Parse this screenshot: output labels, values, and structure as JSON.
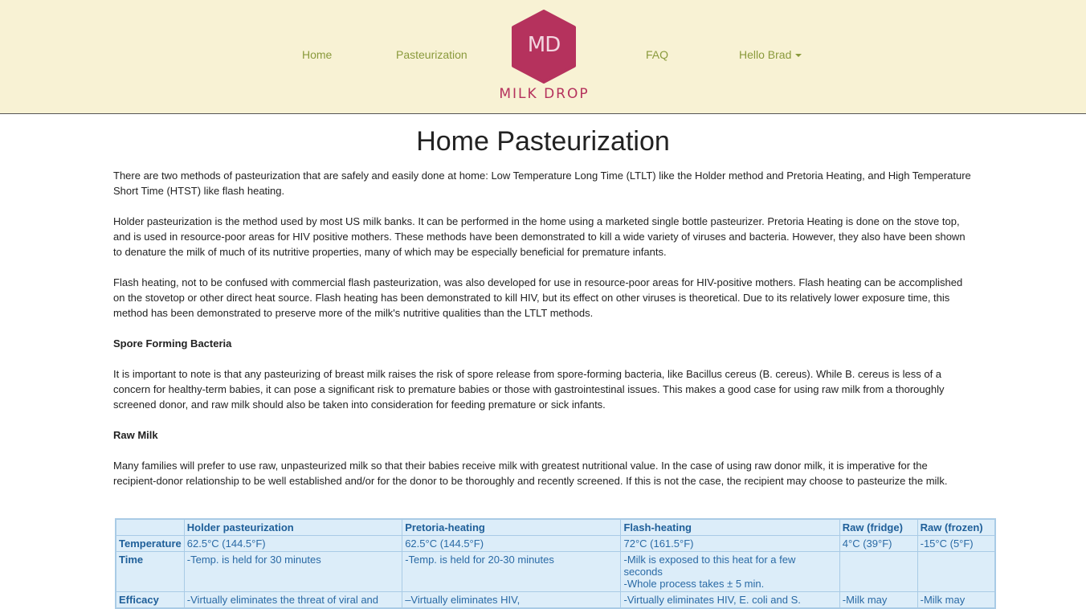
{
  "nav": {
    "home": "Home",
    "pasteurization": "Pasteurization",
    "faq": "FAQ",
    "user_menu": "Hello Brad"
  },
  "logo": {
    "monogram": "MD",
    "wordmark": "MILK DROP",
    "color": "#b5325d"
  },
  "page": {
    "title": "Home Pasteurization",
    "para1": "There are two methods of pasteurization that are safely and easily done at home: Low Temperature Long Time (LTLT) like the Holder method and Pretoria Heating, and High Temperature Short Time (HTST) like flash heating.",
    "para2": "Holder pasteurization is the method used by most US milk banks. It can be performed in the home using a marketed single bottle pasteurizer. Pretoria Heating is done on the stove top, and is used in resource-poor areas for HIV positive mothers. These methods have been demonstrated to kill a wide variety of viruses and bacteria. However, they also have been shown to denature the milk of much of its nutritive properties, many of which may be especially beneficial for premature infants.",
    "para3": "Flash heating, not to be confused with commercial flash pasteurization, was also developed for use in resource-poor areas for HIV-positive mothers. Flash heating can be accomplished on the stovetop or other direct heat source. Flash heating has been demonstrated to kill HIV, but its effect on other viruses is theoretical. Due to its relatively lower exposure time, this method has been demonstrated to preserve more of the milk's nutritive qualities than the LTLT methods.",
    "heading_spore": "Spore Forming Bacteria",
    "para4": "It is important to note is that any pasteurizing of breast milk raises the risk of spore release from spore-forming bacteria, like Bacillus cereus (B. cereus). While B. cereus is less of a concern for healthy-term babies, it can pose a significant risk to premature babies or those with gastrointestinal issues. This makes a good case for using raw milk from a thoroughly screened donor, and raw milk should also be taken into consideration for feeding premature or sick infants.",
    "heading_raw": "Raw Milk",
    "para5": "Many families will prefer to use raw, unpasteurized milk so that their babies receive milk with greatest nutritional value. In the case of using raw donor milk, it is imperative for the recipient-donor relationship to be well established and/or for the donor to be thoroughly and recently screened. If this is not the case, the recipient may choose to pasteurize the milk."
  },
  "table": {
    "headers": [
      "",
      "Holder pasteurization",
      "Pretoria-heating",
      "Flash-heating",
      "Raw (fridge)",
      "Raw (frozen)"
    ],
    "rows": [
      {
        "label": "Temperature",
        "cells": [
          "62.5°C (144.5°F)",
          "62.5°C (144.5°F)",
          "72°C (161.5°F)",
          "4°C (39°F)",
          "-15°C (5°F)"
        ]
      },
      {
        "label": "Time",
        "cells": [
          "-Temp. is held for 30 minutes",
          "-Temp. is held for 20-30 minutes",
          "-Milk is exposed to this heat for a few seconds",
          "",
          ""
        ],
        "extra": "-Whole process takes ± 5 min."
      },
      {
        "label": "Efficacy",
        "cells": [
          "-Virtually eliminates the threat of viral and",
          "–Virtually eliminates HIV,",
          "-Virtually eliminates HIV, E. coli and S.",
          "-Milk may",
          "-Milk may"
        ]
      }
    ]
  }
}
